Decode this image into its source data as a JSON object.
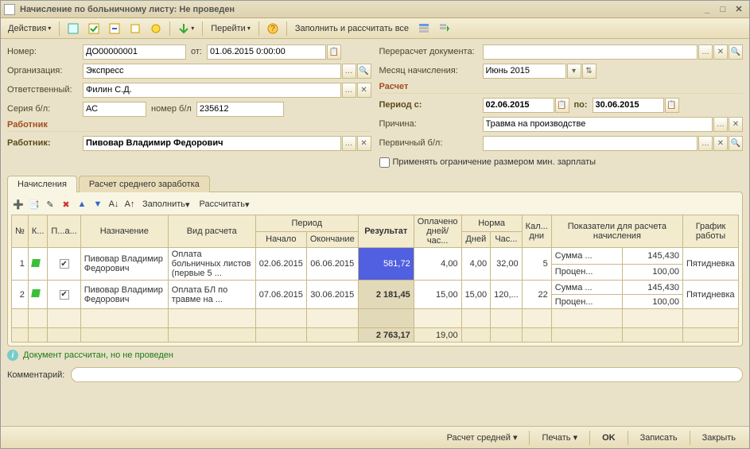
{
  "window": {
    "title": "Начисление по больничному листу: Не проведен"
  },
  "toolbar": {
    "actions": "Действия",
    "go": "Перейти",
    "fill": "Заполнить и рассчитать все"
  },
  "labels": {
    "number": "Номер:",
    "from": "от:",
    "org": "Организация:",
    "responsible": "Ответственный:",
    "series": "Серия б/л:",
    "series_no": "номер б/л",
    "worker_section": "Работник",
    "worker": "Работник:",
    "recalc": "Перерасчет документа:",
    "month": "Месяц начисления:",
    "calc_section": "Расчет",
    "period_from": "Период с:",
    "period_to": "по:",
    "reason": "Причина:",
    "primary": "Первичный б/л:",
    "apply_limit": "Применять ограничение размером мин. зарплаты",
    "comment": "Комментарий:"
  },
  "values": {
    "number": "ДО00000001",
    "date": "01.06.2015 0:00:00",
    "org": "Экспресс",
    "responsible": "Филин С.Д.",
    "series": "АС",
    "series_no": "235612",
    "worker": "Пивовар Владимир Федорович",
    "month": "Июнь 2015",
    "period_from": "02.06.2015",
    "period_to": "30.06.2015",
    "reason": "Травма на производстве",
    "primary": "",
    "comment": ""
  },
  "tabs": [
    "Начисления",
    "Расчет среднего заработка"
  ],
  "grid_toolbar": {
    "fill": "Заполнить",
    "calc": "Рассчитать"
  },
  "grid": {
    "headers": {
      "no": "№",
      "k": "К...",
      "p": "П...а...",
      "name": "Назначение",
      "calc_type": "Вид расчета",
      "period": "Период",
      "start": "Начало",
      "end": "Окончание",
      "result": "Результат",
      "paid": "Оплачено дней/час...",
      "norm": "Норма",
      "days": "Дней",
      "hours": "Час...",
      "cal": "Кал... дни",
      "inds": "Показатели для расчета начисления",
      "schedule": "График работы"
    },
    "ind_lbls": {
      "sum": "Сумма ...",
      "pct": "Процен..."
    },
    "rows": [
      {
        "no": "1",
        "name": "Пивовар Владимир Федорович",
        "calc_type": "Оплата больничных листов (первые 5 ...",
        "start": "02.06.2015",
        "end": "06.06.2015",
        "result": "581,72",
        "paid": "4,00",
        "days": "4,00",
        "hours": "32,00",
        "cal": "5",
        "ind_sum": "145,430",
        "ind_pct": "100,00",
        "schedule": "Пятидневка"
      },
      {
        "no": "2",
        "name": "Пивовар Владимир Федорович",
        "calc_type": "Оплата БЛ по травме на ...",
        "start": "07.06.2015",
        "end": "30.06.2015",
        "result": "2 181,45",
        "paid": "15,00",
        "days": "15,00",
        "hours": "120,...",
        "cal": "22",
        "ind_sum": "145,430",
        "ind_pct": "100,00",
        "schedule": "Пятидневка"
      }
    ],
    "totals": {
      "result": "2 763,17",
      "paid": "19,00"
    }
  },
  "status": "Документ рассчитан, но не проведен",
  "footer": {
    "calc_avg": "Расчет средней",
    "print": "Печать",
    "ok": "OK",
    "save": "Записать",
    "close": "Закрыть"
  }
}
